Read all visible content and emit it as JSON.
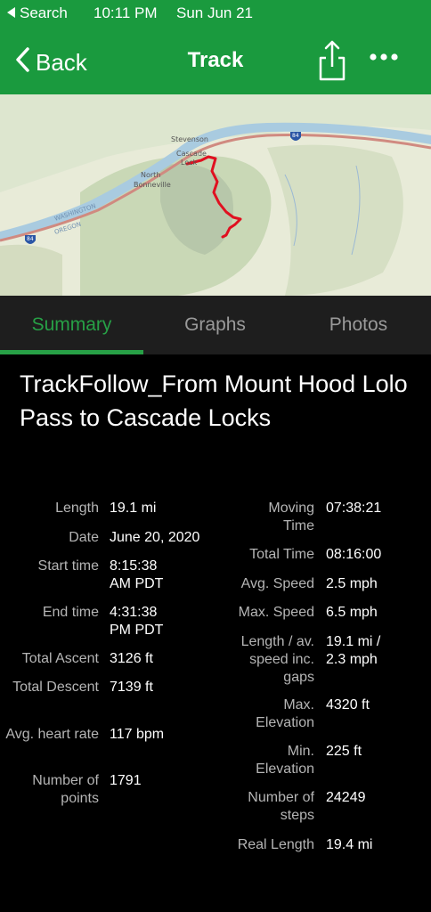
{
  "status": {
    "back_app": "Search",
    "time": "10:11 PM",
    "date": "Sun Jun 21"
  },
  "nav": {
    "back_label": "Back",
    "title": "Track"
  },
  "map": {
    "labels": [
      "Stevenson",
      "Cascade",
      "Lock",
      "North",
      "Bonneville",
      "WASHINGTON",
      "OREGON",
      "84",
      "84"
    ]
  },
  "tabs": {
    "summary": "Summary",
    "graphs": "Graphs",
    "photos": "Photos"
  },
  "track_title": "TrackFollow_From Mount Hood Lolo Pass to Cascade Locks",
  "left_stats": [
    {
      "label": "Length",
      "value": "19.1 mi"
    },
    {
      "label": "Date",
      "value": "June 20, 2020"
    },
    {
      "label": "Start time",
      "value": "8:15:38 AM PDT"
    },
    {
      "label": "End time",
      "value": "4:31:38 PM PDT"
    },
    {
      "label": "Total Ascent",
      "value": "3126 ft"
    },
    {
      "label": "Total Descent",
      "value": "7139 ft"
    },
    {
      "label": "Avg. heart rate",
      "value": "117 bpm"
    },
    {
      "label": "Number of points",
      "value": "1791"
    }
  ],
  "right_stats": [
    {
      "label": "Moving Time",
      "value": "07:38:21"
    },
    {
      "label": "Total Time",
      "value": "08:16:00"
    },
    {
      "label": "Avg. Speed",
      "value": "2.5 mph"
    },
    {
      "label": "Max. Speed",
      "value": "6.5 mph"
    },
    {
      "label": "Length / av. speed inc. gaps",
      "value": "19.1 mi / 2.3 mph"
    },
    {
      "label": "Max. Elevation",
      "value": "4320 ft"
    },
    {
      "label": "Min. Elevation",
      "value": "225 ft"
    },
    {
      "label": "Number of steps",
      "value": "24249"
    },
    {
      "label": "Real Length",
      "value": "19.4 mi"
    }
  ],
  "colors": {
    "brand_green": "#1a9a3e",
    "track_red": "#e01020"
  }
}
